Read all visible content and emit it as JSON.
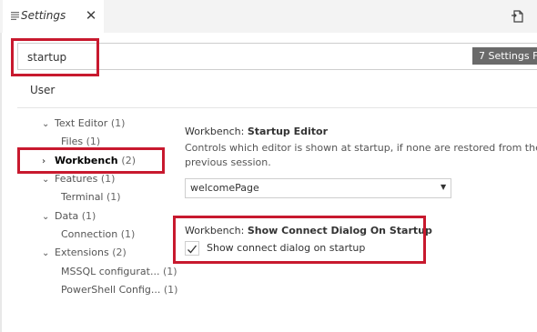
{
  "tab": {
    "title": "Settings",
    "close_glyph": "✕",
    "icon": "list-icon"
  },
  "toolbar": {
    "open_json_icon": "open-settings-json-icon"
  },
  "search": {
    "value": "startup",
    "result_count": "7 Settings Fo"
  },
  "scope": {
    "user_label": "User"
  },
  "toc": [
    {
      "label": "Text Editor",
      "count": "(1)",
      "expanded": true
    },
    {
      "label": "Files",
      "count": "(1)"
    },
    {
      "label": "Workbench",
      "count": "(2)",
      "selected": true
    },
    {
      "label": "Features",
      "count": "(1)",
      "expanded": true
    },
    {
      "label": "Terminal",
      "count": "(1)"
    },
    {
      "label": "Data",
      "count": "(1)",
      "expanded": true
    },
    {
      "label": "Connection",
      "count": "(1)"
    },
    {
      "label": "Extensions",
      "count": "(2)",
      "expanded": true
    },
    {
      "label": "MSSQL configurat...",
      "count": "(1)"
    },
    {
      "label": "PowerShell Config...",
      "count": "(1)"
    }
  ],
  "settings": {
    "startup_editor": {
      "category": "Workbench: ",
      "name": "Startup Editor",
      "description": "Controls which editor is shown at startup, if none are restored from the previous session.",
      "value": "welcomePage"
    },
    "show_connect_dialog": {
      "category": "Workbench: ",
      "name": "Show Connect Dialog On Startup",
      "checkbox_label": "Show connect dialog on startup",
      "checked": true
    }
  },
  "colors": {
    "highlight": "#c8192e",
    "badge": "#6a6a6a"
  }
}
